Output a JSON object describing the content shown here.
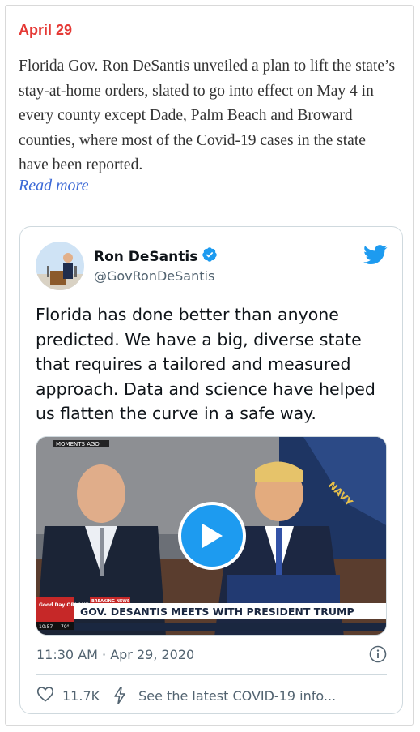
{
  "entry": {
    "date": "April 29",
    "summary": "Florida Gov. Ron DeSantis unveiled a plan to lift the state’s stay-at-home orders, slated to go into effect on May 4 in every county except Dade, Palm Beach and Broward counties, where most of the Covid-19 cases in the state have been reported.",
    "read_more": "Read more"
  },
  "tweet": {
    "author_name": "Ron DeSantis",
    "handle": "@GovRonDeSantis",
    "text": "Florida has done better than anyone predicted. We have a big, diverse state that requires a tailored and measured approach. Data and science have helped us flatten the curve in a safe way.",
    "media": {
      "lower_third": "GOV. DESANTIS MEETS WITH PRESIDENT TRUMP",
      "top_label": "MOMENTS AGO",
      "station": "Good Day ORLANDO",
      "time": "10:57",
      "temp": "70°",
      "breaking": "BREAKING NEWS",
      "flag_text": "NAVY"
    },
    "timestamp": "11:30 AM · Apr 29, 2020",
    "like_count": "11.7K",
    "covid_link": "See the latest COVID-19 info..."
  },
  "colors": {
    "date_red": "#e53935",
    "link_blue": "#3b68d6",
    "twitter_blue": "#1d9bf0"
  }
}
